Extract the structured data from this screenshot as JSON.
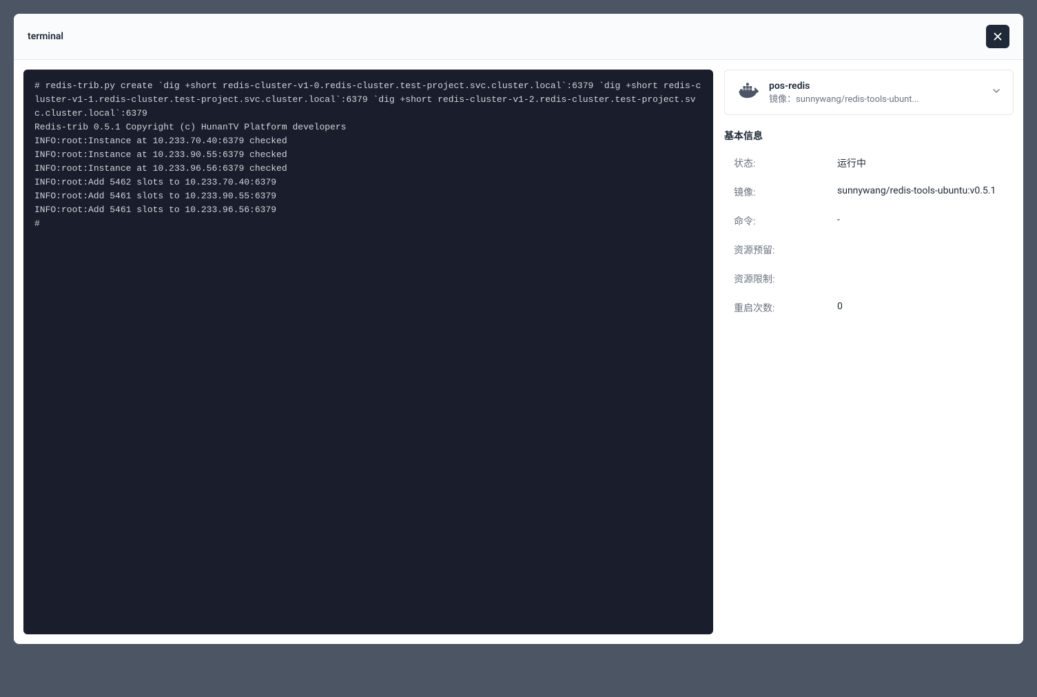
{
  "header": {
    "title": "terminal"
  },
  "terminal": {
    "content": "# redis-trib.py create `dig +short redis-cluster-v1-0.redis-cluster.test-project.svc.cluster.local`:6379 `dig +short redis-cluster-v1-1.redis-cluster.test-project.svc.cluster.local`:6379 `dig +short redis-cluster-v1-2.redis-cluster.test-project.svc.cluster.local`:6379\nRedis-trib 0.5.1 Copyright (c) HunanTV Platform developers\nINFO:root:Instance at 10.233.70.40:6379 checked\nINFO:root:Instance at 10.233.90.55:6379 checked\nINFO:root:Instance at 10.233.96.56:6379 checked\nINFO:root:Add 5462 slots to 10.233.70.40:6379\nINFO:root:Add 5461 slots to 10.233.90.55:6379\nINFO:root:Add 5461 slots to 10.233.96.56:6379\n#"
  },
  "container": {
    "name": "pos-redis",
    "image_prefix": "镜像：",
    "image_short": "sunnywang/redis-tools-ubunt..."
  },
  "info": {
    "section_title": "基本信息",
    "rows": [
      {
        "label": "状态:",
        "value": "运行中"
      },
      {
        "label": "镜像:",
        "value": "sunnywang/redis-tools-ubuntu:v0.5.1"
      },
      {
        "label": "命令:",
        "value": "-"
      },
      {
        "label": "资源预留:",
        "value": ""
      },
      {
        "label": "资源限制:",
        "value": ""
      },
      {
        "label": "重启次数:",
        "value": "0"
      }
    ]
  }
}
